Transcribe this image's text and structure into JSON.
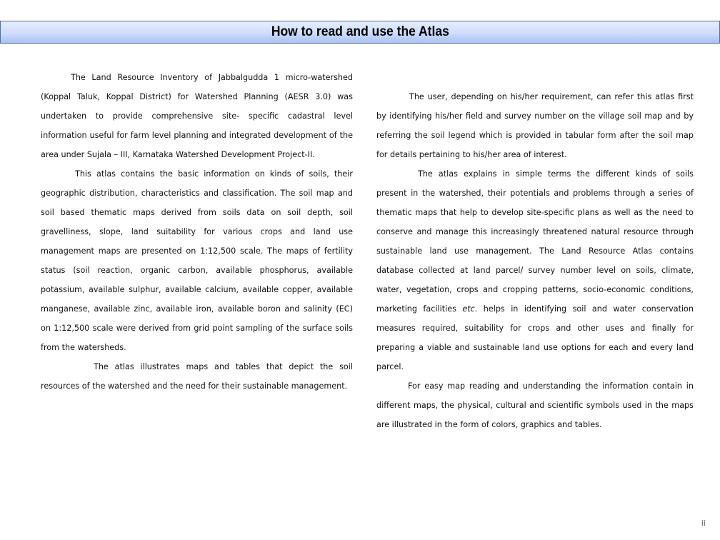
{
  "header": {
    "title": "How to read and use the Atlas"
  },
  "left_column": {
    "paragraphs": [
      "The Land Resource Inventory of Jabbalgudda 1  micro-watershed (Koppal  Taluk, Koppal District) for Watershed Planning (AESR 3.0) was undertaken to provide comprehensive site- specific cadastral level information useful for farm level planning and integrated development of the area under Sujala – III, Karnataka Watershed Development Project-II.",
      "This atlas contains the basic information on kinds of soils, their geographic distribution, characteristics and classification. The soil map and soil based thematic maps derived from soils data on soil depth, soil gravelliness, slope, land suitability for various crops and land use management maps are presented on 1:12,500 scale. The maps of fertility status (soil reaction, organic carbon, available phosphorus, available potassium, available sulphur, available calcium,  available copper, available manganese, available zinc, available iron, available boron and salinity (EC) on 1:12,500 scale were derived from grid point sampling of the surface soils from the watersheds.",
      "The atlas illustrates maps and tables that depict the soil resources  of  the watershed and the need for their sustainable management."
    ]
  },
  "right_column": {
    "paragraphs": [
      "The user, depending on his/her requirement, can refer this atlas first by identifying his/her field and survey number on the village soil map and by referring the soil legend which is provided in tabular form after the soil map for details pertaining to his/her area of interest.",
      {
        "before_italic": "The atlas explains in  simple terms the different kinds of soils present in the watershed, their potentials and problems through a series of thematic maps that help to develop site-specific plans as well as the need to conserve and manage this increasingly threatened natural resource through sustainable land use management. The Land Resource Atlas contains database collected at land parcel/ survey number level  on soils, climate, water, vegetation, crops and cropping patterns, socio-economic conditions, marketing facilities ",
        "italic": "etc",
        "after_italic": ". helps in identifying soil and water conservation measures required, suitability for crops and other uses and finally for preparing a viable and sustainable land use options for each and every land parcel."
      },
      "For easy map reading and understanding the information contain in different maps, the physical, cultural and scientific symbols used in the maps are illustrated in the form of colors, graphics and tables."
    ]
  },
  "footer": {
    "page_number": "ii"
  }
}
